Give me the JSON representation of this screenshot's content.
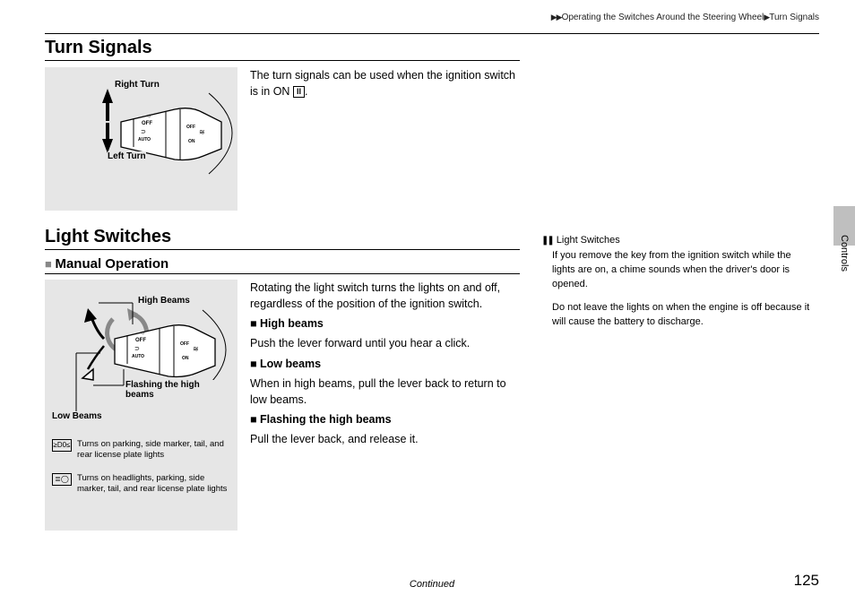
{
  "breadcrumb": {
    "seg1": "Operating the Switches Around the Steering Wheel",
    "seg2": "Turn Signals"
  },
  "tab": {
    "label": "Controls"
  },
  "section1": {
    "title": "Turn Signals",
    "fig": {
      "label_right": "Right Turn",
      "label_left": "Left Turn",
      "dial_off": "OFF",
      "dial_auto": "AUTO",
      "dial_on": "ON"
    },
    "text_pre": "The turn signals can be used when the ignition switch is in ON ",
    "text_ii": "II",
    "text_post": "."
  },
  "section2": {
    "title": "Light Switches",
    "subtitle": "Manual Operation",
    "fig": {
      "label_high": "High Beams",
      "label_flash": "Flashing the high beams",
      "label_low": "Low Beams",
      "dial_off": "OFF",
      "dial_auto": "AUTO",
      "dial_on": "ON",
      "legend1": "Turns on parking, side marker, tail, and rear license plate lights",
      "legend2": "Turns on headlights, parking, side marker, tail, and rear license plate lights"
    },
    "intro": "Rotating the light switch turns the lights on and off, regardless of the position of the ignition switch.",
    "h_high": "High beams",
    "p_high": "Push the lever forward until you hear a click.",
    "h_low": "Low beams",
    "p_low": "When in high beams, pull the lever back to return to low beams.",
    "h_flash": "Flashing the high beams",
    "p_flash": "Pull the lever back, and release it."
  },
  "side": {
    "title": "Light Switches",
    "p1": "If you remove the key from the ignition switch while the lights are on, a chime sounds when the driver's door is opened.",
    "p2": "Do not leave the lights on when the engine is off because it will cause the battery to discharge."
  },
  "footer": {
    "continued": "Continued",
    "page": "125"
  }
}
